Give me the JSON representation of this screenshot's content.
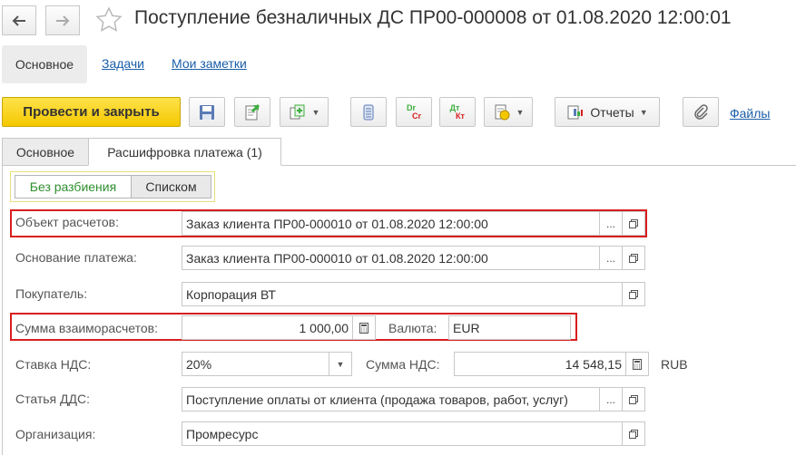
{
  "header": {
    "title": "Поступление безналичных ДС ПР00-000008 от 01.08.2020 12:00:01",
    "icons": [
      "arrow-left-icon",
      "arrow-right-icon",
      "star-icon"
    ]
  },
  "nav_panel": {
    "items": [
      "Основное",
      "Задачи",
      "Мои заметки"
    ]
  },
  "toolbar": {
    "post_close_label": "Провести и закрыть",
    "reports_label": "Отчеты",
    "files_label": "Файлы",
    "dr_cr_label": {
      "top": "Dr",
      "bottom": "Cr"
    },
    "dt_kt_label": {
      "top": "Дт",
      "bottom": "Кт"
    }
  },
  "tabs": [
    "Основное",
    "Расшифровка платежа (1)"
  ],
  "split_mode": {
    "options": [
      "Без разбиения",
      "Списком"
    ],
    "selected": "Без разбиения"
  },
  "form": {
    "settlement_object": {
      "label": "Объект расчетов:",
      "value": "Заказ клиента ПР00-000010 от 01.08.2020 12:00:00"
    },
    "payment_basis": {
      "label": "Основание платежа:",
      "value": "Заказ клиента ПР00-000010 от 01.08.2020 12:00:00"
    },
    "buyer": {
      "label": "Покупатель:",
      "value": "Корпорация ВТ"
    },
    "settlement_amount": {
      "label": "Сумма взаиморасчетов:",
      "value": "1 000,00"
    },
    "currency": {
      "label": "Валюта:",
      "value": "EUR"
    },
    "vat_rate": {
      "label": "Ставка НДС:",
      "value": "20%"
    },
    "vat_amount": {
      "label": "Сумма НДС:",
      "value": "14 548,15",
      "currency": "RUB"
    },
    "cash_flow_item": {
      "label": "Статья ДДС:",
      "value": "Поступление оплаты от клиента (продажа товаров, работ, услуг)"
    },
    "organization": {
      "label": "Организация:",
      "value": "Промресурс"
    }
  },
  "select_button_label": "...",
  "colors": {
    "accent_yellow": "#f4c800",
    "link_blue": "#1a5ea8",
    "highlight_red": "#d81e1e",
    "selected_green": "#2f8f2f"
  }
}
